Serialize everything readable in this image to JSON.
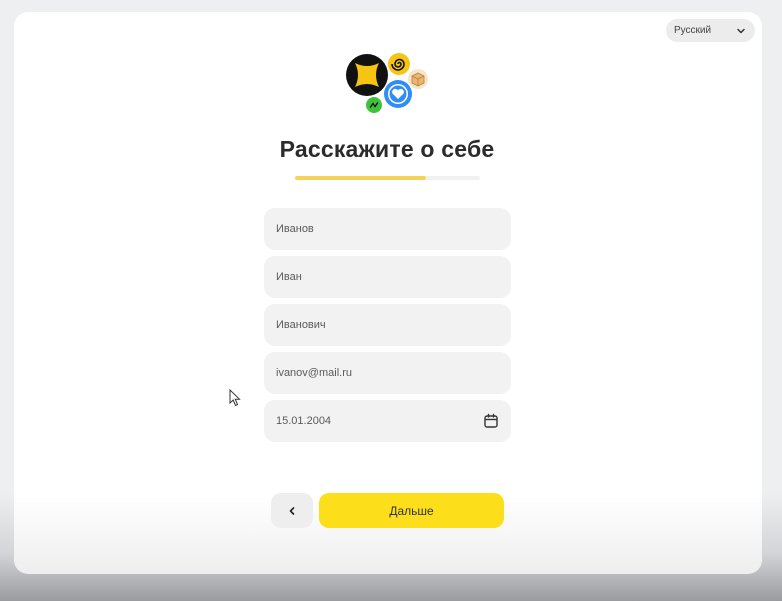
{
  "language": {
    "selected": "Русский",
    "icon": "chevron-down-icon"
  },
  "header": {
    "title": "Расскажите о себе"
  },
  "progress": {
    "fraction": 0.71,
    "fill_color": "#f3d35a",
    "track_color": "#f1f1f1"
  },
  "form": {
    "last_name": "Иванов",
    "first_name": "Иван",
    "middle_name": "Иванович",
    "email": "ivanov@mail.ru",
    "birth_date": "15.01.2004",
    "date_icon": "calendar-icon"
  },
  "actions": {
    "back_icon": "chevron-left-icon",
    "next_label": "Дальше",
    "next_color": "#fcdf1a"
  },
  "colors": {
    "accent": "#fcdf1a",
    "field_bg": "#f2f2f2",
    "text": "#2b2b2b"
  }
}
